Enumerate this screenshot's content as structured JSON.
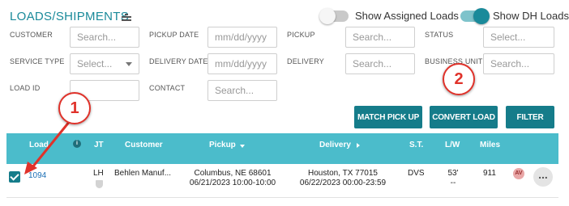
{
  "header": {
    "title": "LOADS/SHIPMENTS",
    "toggles": [
      {
        "label": "Show Assigned Loads",
        "on": false
      },
      {
        "label": "Show DH Loads",
        "on": true
      }
    ]
  },
  "filters": {
    "customer": {
      "label": "CUSTOMER",
      "placeholder": "Search..."
    },
    "service_type": {
      "label": "SERVICE TYPE",
      "placeholder": "Select..."
    },
    "load_id": {
      "label": "LOAD ID",
      "placeholder": ""
    },
    "pickup_date": {
      "label": "PICKUP DATE",
      "placeholder": "mm/dd/yyyy"
    },
    "delivery_date": {
      "label": "DELIVERY DATE",
      "placeholder": "mm/dd/yyyy"
    },
    "contact": {
      "label": "CONTACT",
      "placeholder": "Search..."
    },
    "pickup": {
      "label": "PICKUP",
      "placeholder": "Search..."
    },
    "delivery": {
      "label": "DELIVERY",
      "placeholder": "Search..."
    },
    "status": {
      "label": "STATUS",
      "placeholder": "Select..."
    },
    "business_unit": {
      "label": "BUSINESS UNIT",
      "placeholder": "Search..."
    }
  },
  "actions": {
    "match_pickup": "MATCH PICK UP",
    "convert_load": "CONVERT LOAD",
    "filter": "FILTER"
  },
  "table": {
    "columns": {
      "load": "Load",
      "jt": "JT",
      "customer": "Customer",
      "pickup": "Pickup",
      "delivery": "Delivery",
      "st": "S.T.",
      "lw": "L/W",
      "miles": "Miles"
    },
    "rows": [
      {
        "load_id": "1094",
        "jt": "LH",
        "customer": "Behlen Manuf...",
        "pickup_city": "Columbus, NE 68601",
        "pickup_time": "06/21/2023 10:00-10:00",
        "delivery_city": "Houston, TX 77015",
        "delivery_time": "06/22/2023 00:00-23:59",
        "st": "DVS",
        "length": "53'",
        "width": "--",
        "miles": "911",
        "badge": "AV",
        "more": "..."
      }
    ]
  },
  "annotations": {
    "marker1": "1",
    "marker2": "2",
    "color": "#e0322a"
  },
  "colors": {
    "accent": "#1a8a9a",
    "button": "#157c8a",
    "header": "#4bbccb",
    "link": "#1b6fb5"
  }
}
